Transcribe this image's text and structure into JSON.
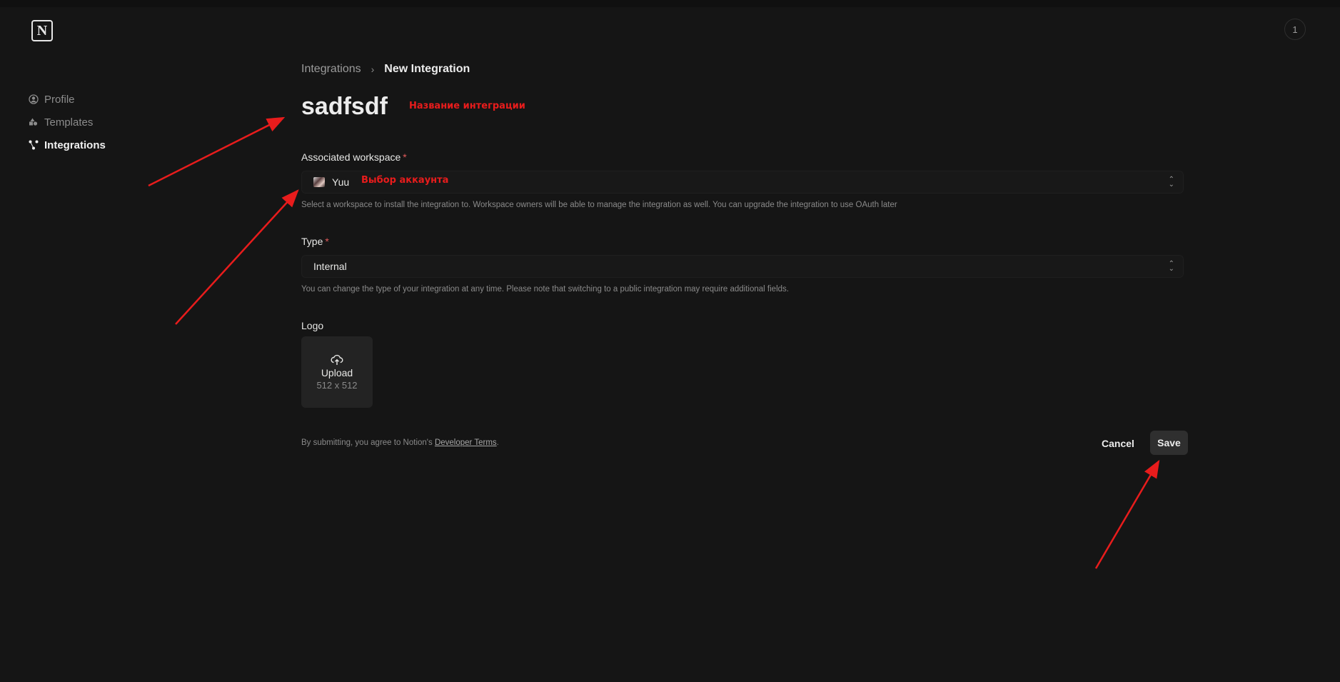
{
  "app": {
    "logo_letter": "N",
    "notification_count": "1"
  },
  "sidebar": {
    "items": [
      {
        "label": "Profile",
        "icon": "user-circle-icon",
        "active": false
      },
      {
        "label": "Templates",
        "icon": "templates-icon",
        "active": false
      },
      {
        "label": "Integrations",
        "icon": "integrations-icon",
        "active": true
      }
    ]
  },
  "breadcrumb": {
    "parent": "Integrations",
    "current": "New Integration"
  },
  "page": {
    "title": "sadfsdf"
  },
  "annotations": {
    "title_note": "Название интеграции",
    "workspace_note": "Выбор аккаунта"
  },
  "form": {
    "workspace": {
      "label": "Associated workspace",
      "required_mark": "*",
      "value": "Yuu",
      "help": "Select a workspace to install the integration to. Workspace owners will be able to manage the integration as well. You can upgrade the integration to use OAuth later"
    },
    "type": {
      "label": "Type",
      "required_mark": "*",
      "value": "Internal",
      "help": "You can change the type of your integration at any time. Please note that switching to a public integration may require additional fields."
    },
    "logo": {
      "label": "Logo",
      "upload_label": "Upload",
      "size_hint": "512 x 512"
    }
  },
  "footer": {
    "terms_prefix": "By submitting, you agree to Notion's ",
    "terms_link": "Developer Terms",
    "terms_suffix": ".",
    "cancel_label": "Cancel",
    "save_label": "Save"
  },
  "colors": {
    "background": "#151515",
    "annotation": "#e81c1c",
    "required": "#e05a5a"
  }
}
